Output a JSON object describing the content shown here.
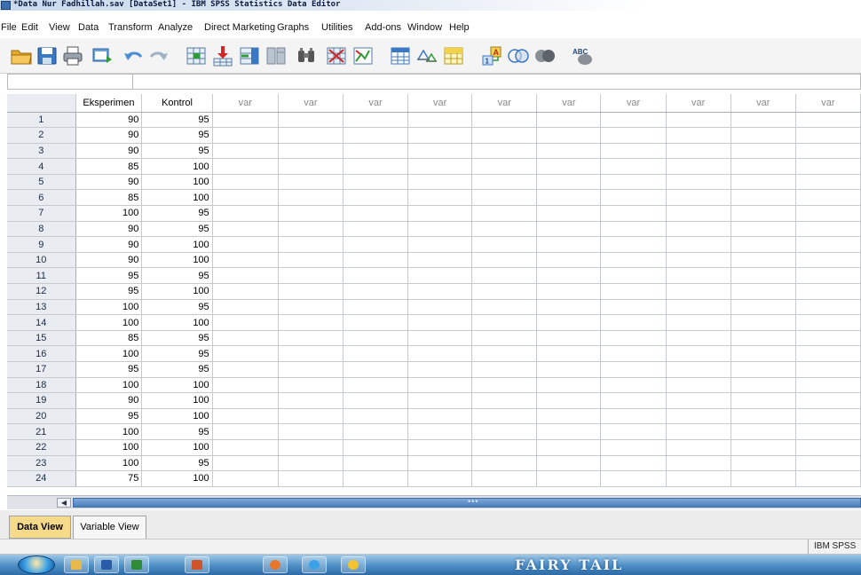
{
  "window": {
    "title": "*Data Nur Fadhillah.sav [DataSet1] - IBM SPSS Statistics Data Editor"
  },
  "menu": {
    "file": "File",
    "edit": "Edit",
    "view": "View",
    "data": "Data",
    "transform": "Transform",
    "analyze": "Analyze",
    "direct_marketing": "Direct Marketing",
    "graphs": "Graphs",
    "utilities": "Utilities",
    "add_ons": "Add-ons",
    "window": "Window",
    "help": "Help"
  },
  "toolbar": {
    "icons": [
      "open-folder-icon",
      "save-icon",
      "print-icon",
      "dialog-recall-icon",
      "undo-icon",
      "redo-icon",
      "go-to-case-icon",
      "insert-cases-icon",
      "insert-variable-icon",
      "split-file-icon",
      "find-icon",
      "select-cases-icon",
      "weight-cases-icon",
      "value-labels-icon",
      "use-sets-icon",
      "show-all-variables-icon",
      "value-labels-toggle-icon",
      "custom-circles-icon",
      "spell-check-icon"
    ],
    "value_labels_text": "A",
    "value_labels_num": "1",
    "spell_text": "ABC"
  },
  "grid": {
    "columns": [
      "Eksperimen",
      "Kontrol",
      "var",
      "var",
      "var",
      "var",
      "var",
      "var",
      "var",
      "var",
      "var",
      "var"
    ],
    "rows": [
      [
        "1",
        "90",
        "95"
      ],
      [
        "2",
        "90",
        "95"
      ],
      [
        "3",
        "90",
        "95"
      ],
      [
        "4",
        "85",
        "100"
      ],
      [
        "5",
        "90",
        "100"
      ],
      [
        "6",
        "85",
        "100"
      ],
      [
        "7",
        "100",
        "95"
      ],
      [
        "8",
        "90",
        "95"
      ],
      [
        "9",
        "90",
        "100"
      ],
      [
        "10",
        "90",
        "100"
      ],
      [
        "11",
        "95",
        "95"
      ],
      [
        "12",
        "95",
        "100"
      ],
      [
        "13",
        "100",
        "95"
      ],
      [
        "14",
        "100",
        "100"
      ],
      [
        "15",
        "85",
        "95"
      ],
      [
        "16",
        "100",
        "95"
      ],
      [
        "17",
        "95",
        "95"
      ],
      [
        "18",
        "100",
        "100"
      ],
      [
        "19",
        "90",
        "100"
      ],
      [
        "20",
        "95",
        "100"
      ],
      [
        "21",
        "100",
        "95"
      ],
      [
        "22",
        "100",
        "100"
      ],
      [
        "23",
        "100",
        "95"
      ],
      [
        "24",
        "75",
        "100"
      ]
    ]
  },
  "tabs": {
    "data_view": "Data View",
    "variable_view": "Variable View"
  },
  "status": {
    "text": "IBM SPSS"
  },
  "taskbar": {
    "wallpaper_text": "FAIRY TAIL"
  }
}
